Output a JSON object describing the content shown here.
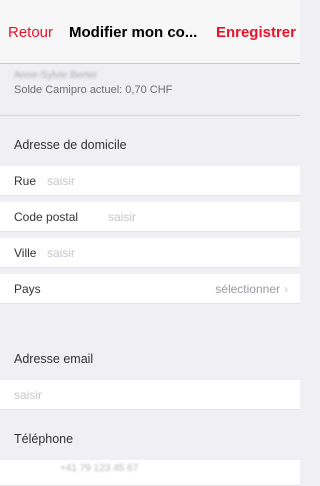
{
  "navbar": {
    "back_label": "Retour",
    "title": "Modifier mon co...",
    "save_label": "Enregistrer"
  },
  "account": {
    "name": "Anne-Sylvie Berter",
    "balance": "Solde Camipro actuel: 0,70 CHF"
  },
  "sections": {
    "home_address": "Adresse de domicile",
    "email": "Adresse email",
    "phone": "Téléphone"
  },
  "fields": {
    "street": {
      "label": "Rue",
      "placeholder": "saisir"
    },
    "postal_code": {
      "label": "Code postal",
      "placeholder": "saisir"
    },
    "city": {
      "label": "Ville",
      "placeholder": "saisir"
    },
    "country": {
      "label": "Pays",
      "value": "sélectionner"
    },
    "email": {
      "placeholder": "saisir"
    },
    "phone": {
      "value": "+41 79 123 45 67"
    }
  },
  "colors": {
    "accent": "#e8132b",
    "background": "#efeff4"
  }
}
